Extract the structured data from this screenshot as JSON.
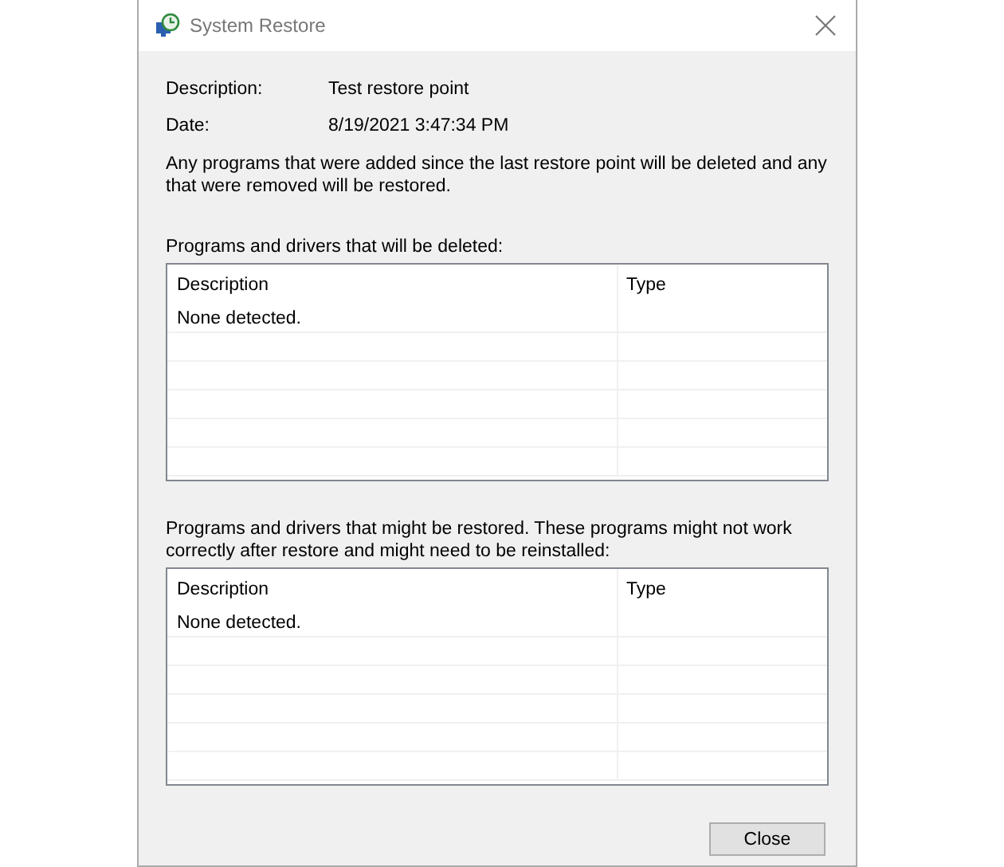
{
  "window": {
    "title": "System Restore"
  },
  "details": [
    {
      "label": "Description:",
      "value": "Test restore point"
    },
    {
      "label": "Date:",
      "value": "8/19/2021 3:47:34 PM"
    }
  ],
  "notice": "Any programs that were added since the last restore point will be deleted and any that were removed will be restored.",
  "tables": [
    {
      "caption": "Programs and drivers that will be deleted:",
      "columns": [
        "Description",
        "Type"
      ],
      "rows": [
        [
          "None detected.",
          ""
        ]
      ]
    },
    {
      "caption": "Programs and drivers that might be restored. These programs might not work correctly after restore and might need to be reinstalled:",
      "columns": [
        "Description",
        "Type"
      ],
      "rows": [
        [
          "None detected.",
          ""
        ]
      ]
    }
  ],
  "buttons": [
    "Close"
  ]
}
